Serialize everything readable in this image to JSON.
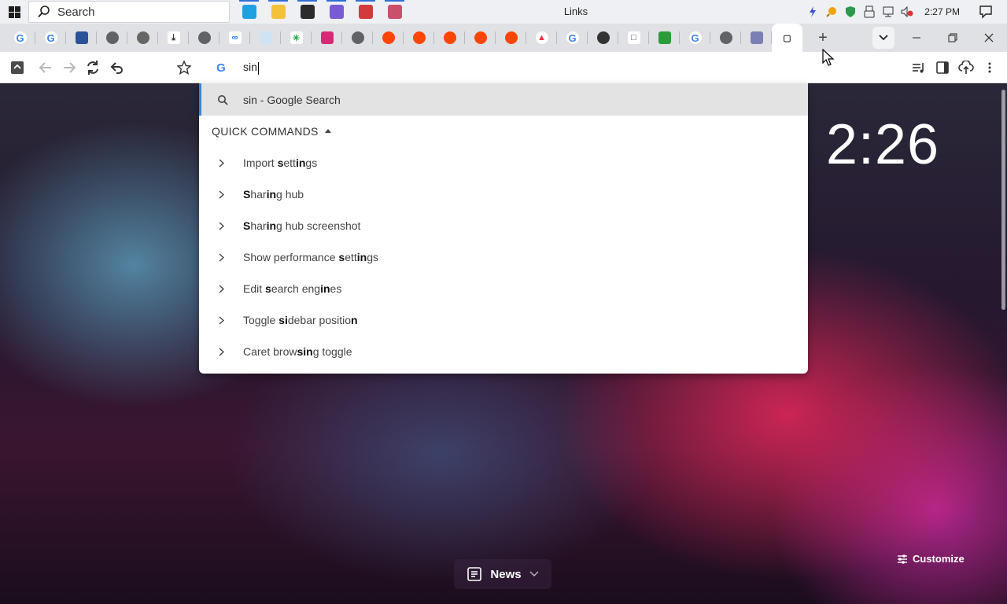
{
  "taskbar": {
    "search_label": "Search",
    "window_title": "Links",
    "clock": "2:27 PM",
    "apps": [
      {
        "name": "edge-app-icon",
        "color": "#1fa0e0",
        "running": true
      },
      {
        "name": "file-explorer-icon",
        "color": "#f3c13a",
        "running": true
      },
      {
        "name": "terminal-app-icon",
        "color": "#2b2b2b",
        "running": true
      },
      {
        "name": "bird-app-icon",
        "color": "#7a5bd6",
        "running": true
      },
      {
        "name": "exe-app-icon",
        "color": "#d23b3b",
        "running": true
      },
      {
        "name": "image-app-icon",
        "color": "#c94f6a",
        "running": true
      }
    ]
  },
  "tabs": [
    {
      "name": "tab-google-1",
      "fav": "g"
    },
    {
      "name": "tab-google-2",
      "fav": "g"
    },
    {
      "name": "tab-weather",
      "fav": "weather"
    },
    {
      "name": "tab-globe-1",
      "fav": "globe"
    },
    {
      "name": "tab-audio",
      "fav": "audio"
    },
    {
      "name": "tab-download",
      "fav": "download"
    },
    {
      "name": "tab-globe-2",
      "fav": "globe"
    },
    {
      "name": "tab-meta",
      "fav": "meta"
    },
    {
      "name": "tab-cloud",
      "fav": "cloud"
    },
    {
      "name": "tab-sparkle",
      "fav": "sparkle"
    },
    {
      "name": "tab-instagram",
      "fav": "instagram"
    },
    {
      "name": "tab-globe-3",
      "fav": "globe"
    },
    {
      "name": "tab-reddit-1",
      "fav": "reddit"
    },
    {
      "name": "tab-reddit-2",
      "fav": "reddit"
    },
    {
      "name": "tab-reddit-3",
      "fav": "reddit"
    },
    {
      "name": "tab-reddit-4",
      "fav": "reddit"
    },
    {
      "name": "tab-reddit-5",
      "fav": "reddit"
    },
    {
      "name": "tab-fire",
      "fav": "fire"
    },
    {
      "name": "tab-google-3",
      "fav": "g"
    },
    {
      "name": "tab-bug",
      "fav": "bug"
    },
    {
      "name": "tab-doc",
      "fav": "doc"
    },
    {
      "name": "tab-green",
      "fav": "green"
    },
    {
      "name": "tab-google-4",
      "fav": "g"
    },
    {
      "name": "tab-globe-4",
      "fav": "globe"
    },
    {
      "name": "tab-avatar",
      "fav": "avatar"
    },
    {
      "name": "tab-active",
      "fav": "active"
    }
  ],
  "omnibox": {
    "value": "sin"
  },
  "dropdown": {
    "suggestion": "sin - Google Search",
    "section_header": "QUICK COMMANDS",
    "commands": [
      [
        {
          "t": "Import "
        },
        {
          "t": "s",
          "b": true
        },
        {
          "t": "e"
        },
        {
          "t": "tt",
          "b": false
        },
        {
          "t": "in",
          "b": true
        },
        {
          "t": "gs"
        }
      ],
      [
        {
          "t": "S",
          "b": true
        },
        {
          "t": "har"
        },
        {
          "t": "in",
          "b": true
        },
        {
          "t": "g hub"
        }
      ],
      [
        {
          "t": "S",
          "b": true
        },
        {
          "t": "har"
        },
        {
          "t": "in",
          "b": true
        },
        {
          "t": "g hub screenshot"
        }
      ],
      [
        {
          "t": "Show performance "
        },
        {
          "t": "s",
          "b": true
        },
        {
          "t": "e"
        },
        {
          "t": "tt"
        },
        {
          "t": "in",
          "b": true
        },
        {
          "t": "gs"
        }
      ],
      [
        {
          "t": "Edit "
        },
        {
          "t": "s",
          "b": true
        },
        {
          "t": "earch eng"
        },
        {
          "t": "in",
          "b": true
        },
        {
          "t": "es"
        }
      ],
      [
        {
          "t": "Toggle "
        },
        {
          "t": "si",
          "b": true
        },
        {
          "t": "debar positio"
        },
        {
          "t": "n",
          "b": true
        }
      ],
      [
        {
          "t": "Caret brow"
        },
        {
          "t": "sin",
          "b": true
        },
        {
          "t": "g toggle"
        }
      ]
    ]
  },
  "ntp": {
    "clock": "2:26",
    "news_label": "News",
    "customize_label": "Customize"
  }
}
